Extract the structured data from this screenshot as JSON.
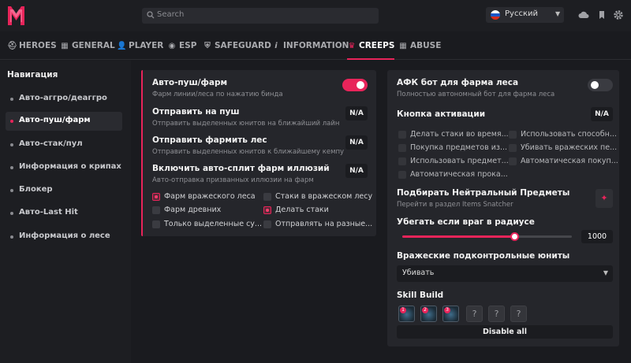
{
  "search": {
    "placeholder": "Search"
  },
  "language": {
    "selected": "Русский"
  },
  "tabs": [
    {
      "label": "HEROES",
      "icon": "hero-icon"
    },
    {
      "label": "GENERAL",
      "icon": "grid-icon"
    },
    {
      "label": "PLAYER",
      "icon": "user-icon"
    },
    {
      "label": "ESP",
      "icon": "eye-icon"
    },
    {
      "label": "SAFEGUARD",
      "icon": "shield-icon"
    },
    {
      "label": "INFORMATION",
      "icon": "info-icon"
    },
    {
      "label": "CREEPS",
      "icon": "creep-icon"
    },
    {
      "label": "ABUSE",
      "icon": "grid-icon"
    }
  ],
  "sidebar": {
    "title": "Навигация",
    "items": [
      {
        "label": "Авто-аггро/деаггро"
      },
      {
        "label": "Авто-пуш/фарм"
      },
      {
        "label": "Авто-стак/пул"
      },
      {
        "label": "Информация о крипах"
      },
      {
        "label": "Блокер"
      },
      {
        "label": "Авто-Last Hit"
      },
      {
        "label": "Информация о лесе"
      }
    ]
  },
  "left_panel": {
    "auto_push": {
      "title": "Авто-пуш/фарм",
      "subtitle": "Фарм линии/леса по нажатию бинда",
      "enabled": true
    },
    "send_push": {
      "title": "Отправить на пуш",
      "subtitle": "Отправить выделенных юнитов на ближайший лайн",
      "bind": "N/A"
    },
    "send_farm": {
      "title": "Отправить фармить лес",
      "subtitle": "Отправить выделенных юнитов к ближайшему кемпу",
      "bind": "N/A"
    },
    "auto_split": {
      "title": "Включить авто-сплит фарм иллюзий",
      "subtitle": "Авто-отправка призванных иллюзии на фарм",
      "bind": "N/A"
    },
    "options": [
      {
        "label": "Фарм вражеского леса",
        "checked": true
      },
      {
        "label": "Стаки в вражеском лесу",
        "checked": false
      },
      {
        "label": "Фарм древних",
        "checked": false
      },
      {
        "label": "Делать стаки",
        "checked": true
      },
      {
        "label": "Только выделенные су...",
        "checked": false
      },
      {
        "label": "Отправлять на разные...",
        "checked": false
      }
    ]
  },
  "right_panel": {
    "afk_bot": {
      "title": "АФК бот для фарма леса",
      "subtitle": "Полностью автономный бот для фарма леса",
      "enabled": false
    },
    "activation_key": {
      "title": "Кнопка активации",
      "bind": "N/A"
    },
    "options": [
      {
        "label": "Делать стаки во время..."
      },
      {
        "label": "Использовать способн..."
      },
      {
        "label": "Покупка предметов из..."
      },
      {
        "label": "Убивать вражеских пе..."
      },
      {
        "label": "Использовать предмет..."
      },
      {
        "label": "Автоматическая покуп..."
      },
      {
        "label": "Автоматическая прока..."
      }
    ],
    "neutral_items": {
      "title": "Подбирать Нейтральный Предметы",
      "subtitle": "Перейти в раздел Items Snatcher",
      "icon": "pin-icon"
    },
    "flee_radius": {
      "title": "Убегать если враг в радиусе",
      "value": "1000",
      "fraction": 0.66
    },
    "enemy_units": {
      "title": "Вражеские подконтрольные юниты",
      "selected": "Убивать"
    },
    "skill_build": {
      "title": "Skill Build",
      "skills": [
        "1",
        "2",
        "3"
      ],
      "empty_slots": [
        "?",
        "?",
        "?"
      ],
      "disable_label": "Disable all"
    }
  },
  "colors": {
    "accent": "#e8245a",
    "background": "#1a1b1f",
    "panel": "#25262b"
  }
}
